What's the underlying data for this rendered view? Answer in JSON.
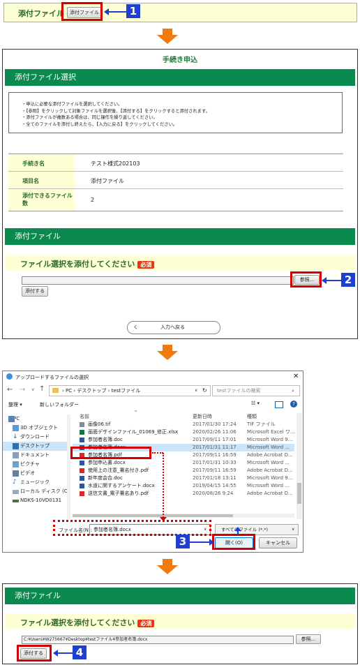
{
  "step1": {
    "label": "添付ファイル",
    "button": "添付ファイル",
    "badge": "1"
  },
  "step2": {
    "header": "手続き申込",
    "section_title": "添付ファイル選択",
    "instructions": [
      "・申込に必要な添付ファイルを選択してください。",
      "・【参照】をクリックして対象ファイルを選択後、【添付する】をクリックすると添付されます。",
      "・添付ファイルが複数ある場合は、同じ操作を繰り返してください。",
      "・全てのファイルを添付し終えたら、【入力に戻る】をクリックしてください。"
    ],
    "table": [
      {
        "label": "手続き名",
        "value": "テスト様式202103"
      },
      {
        "label": "項目名",
        "value": "添付ファイル"
      },
      {
        "label": "添付できるファイル数",
        "value": "2"
      }
    ],
    "attach_title": "添付ファイル",
    "prompt": "ファイル選択を添付してください",
    "required": "必須",
    "browse": "参照...",
    "attach_button": "添付する",
    "back_button": "入力へ戻る",
    "back_chevron": "く",
    "badge": "2"
  },
  "dialog": {
    "title": "アップロードするファイルの選択",
    "path": [
      "PC",
      "デスクトップ",
      "testファイル"
    ],
    "search_placeholder": "testファイルの検索",
    "toolbar": {
      "organize": "整理 ▾",
      "new_folder": "新しいフォルダー"
    },
    "sidebar": [
      "PC",
      "3D オブジェクト",
      "ダウンロード",
      "デスクトップ",
      "ドキュメント",
      "ピクチャ",
      "ビデオ",
      "ミュージック",
      "ローカル ディスク (C",
      "NDKS-10VD0131"
    ],
    "columns": {
      "name": "名前",
      "date": "更新日時",
      "type": "種類"
    },
    "files": [
      {
        "name": "画像06.tif",
        "date": "2017/01/30 17:24",
        "type": "TIF ファイル",
        "icon": "image"
      },
      {
        "name": "画面デザインファイル_01069_修正.xlsx",
        "date": "2020/02/26 11:06",
        "type": "Microsoft Excel ワ...",
        "icon": "excel"
      },
      {
        "name": "参加者名簿.doc",
        "date": "2017/09/11 17:01",
        "type": "Microsoft Word 9...",
        "icon": "word"
      },
      {
        "name": "参加者名簿.docx",
        "date": "2017/01/31 11:17",
        "type": "Microsoft Word ...",
        "icon": "word"
      },
      {
        "name": "参加者名簿.pdf",
        "date": "2017/09/11 16:59",
        "type": "Adobe Acrobat D...",
        "icon": "pdf"
      },
      {
        "name": "参加申込書.docx",
        "date": "2017/01/31 10:33",
        "type": "Microsoft Word ...",
        "icon": "word"
      },
      {
        "name": "使用上の注意_署名付き.pdf",
        "date": "2017/09/11 16:59",
        "type": "Adobe Acrobat D...",
        "icon": "pdf"
      },
      {
        "name": "新年度会合.doc",
        "date": "2017/01/18 13:11",
        "type": "Microsoft Word 9...",
        "icon": "word"
      },
      {
        "name": "水道に関するアンケート.docx",
        "date": "2019/04/15 14:55",
        "type": "Microsoft Word ...",
        "icon": "word"
      },
      {
        "name": "送信文書_電子署名あり.pdf",
        "date": "2020/08/26 9:24",
        "type": "Adobe Acrobat D...",
        "icon": "pdf"
      }
    ],
    "filename_label": "ファイル名(N):",
    "filename_value": "参加者名簿.docx",
    "filetype": "すべてのファイル (*.*)",
    "open": "開く(O)",
    "cancel": "キャンセル",
    "badge": "3"
  },
  "step4": {
    "attach_title": "添付ファイル",
    "prompt": "ファイル選択を添付してください",
    "required": "必須",
    "path_value": "C:¥Users¥W275667¥Desktop¥testファイル¥参加者名簿.docx",
    "browse": "参照...",
    "attach_button": "添付する",
    "badge": "4"
  },
  "colors": {
    "green": "#0a8a4e",
    "yellow": "#ffffd4",
    "red": "#d40000",
    "blue": "#1f3fd0",
    "orange": "#f07a0c"
  }
}
